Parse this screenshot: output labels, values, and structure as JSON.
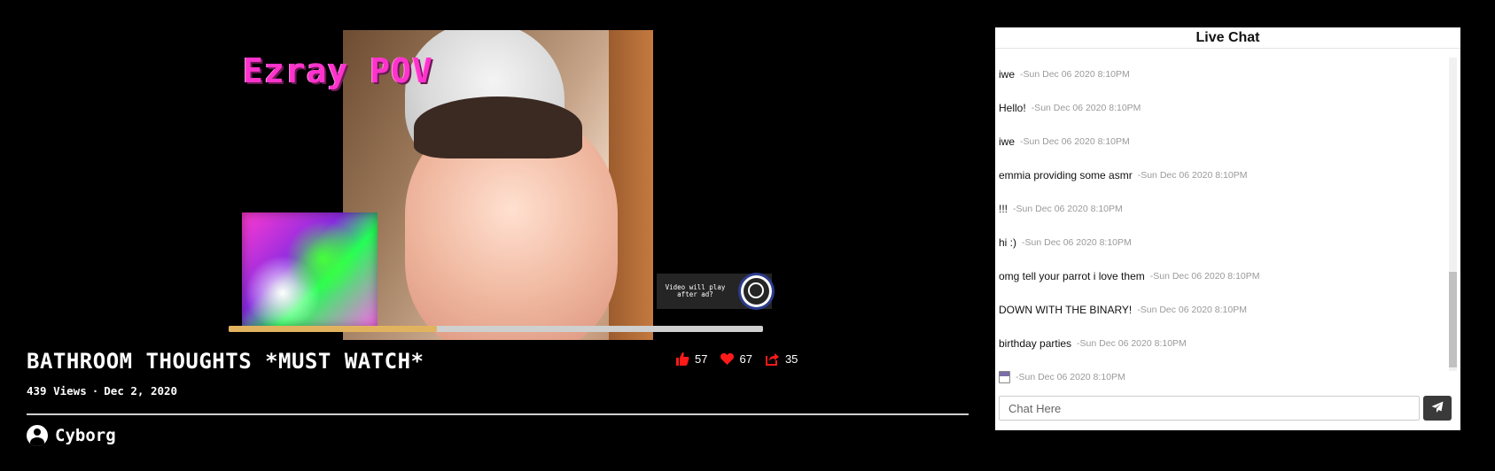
{
  "video": {
    "overlay_title": "Ezray POV",
    "ad_notice": "Video will play after ad?",
    "progress": 0.39,
    "title": "BATHROOM THOUGHTS *MUST WATCH*",
    "views": "439 Views",
    "separator": "·",
    "date": "Dec 2, 2020",
    "emojis": [
      "😱",
      "😱"
    ],
    "stats": {
      "likes": "57",
      "hearts": "67",
      "shares": "35",
      "accent_color": "#ff1a1a"
    },
    "channel_name": "Cyborg"
  },
  "chat": {
    "header": "Live Chat",
    "messages": [
      {
        "text": "iwe",
        "time": "-Sun Dec 06 2020 8:10PM"
      },
      {
        "text": "Hello!",
        "time": "-Sun Dec 06 2020 8:10PM"
      },
      {
        "text": "iwe",
        "time": "-Sun Dec 06 2020 8:10PM"
      },
      {
        "text": "emmia providing some asmr",
        "time": "-Sun Dec 06 2020 8:10PM"
      },
      {
        "text": "!!!",
        "time": "-Sun Dec 06 2020 8:10PM"
      },
      {
        "text": "hi :)",
        "time": "-Sun Dec 06 2020 8:10PM"
      },
      {
        "text": "omg tell your parrot i love them",
        "time": "-Sun Dec 06 2020 8:10PM"
      },
      {
        "text": "DOWN WITH THE BINARY!",
        "time": "-Sun Dec 06 2020 8:10PM"
      },
      {
        "text": "birthday parties",
        "time": "-Sun Dec 06 2020 8:10PM"
      },
      {
        "text": "",
        "icon": "floppy-disk-icon",
        "time": "-Sun Dec 06 2020 8:10PM"
      }
    ],
    "input_placeholder": "Chat Here",
    "send_icon": "paper-plane-icon"
  }
}
